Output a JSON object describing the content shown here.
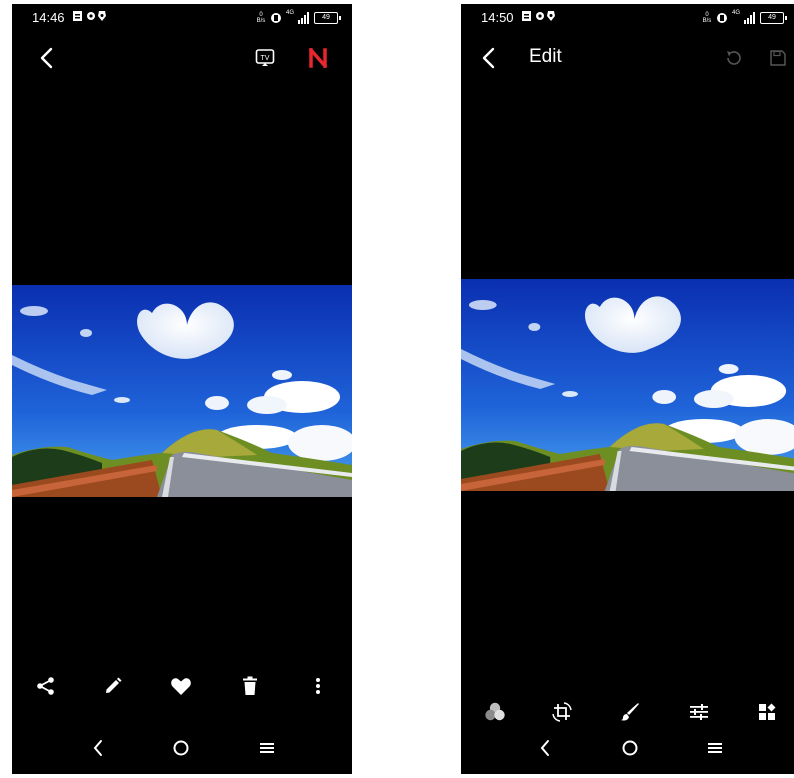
{
  "left_screen": {
    "status": {
      "time": "14:46",
      "netspeed_value": "0",
      "netspeed_unit": "B/s",
      "network": "4G",
      "battery": "49"
    },
    "toolbar_actions": [
      "share-icon",
      "edit-pencil-icon",
      "favorite-heart-icon",
      "delete-trash-icon",
      "more-vertical-icon"
    ],
    "top_actions": [
      "cast-tv-icon",
      "app-logo-icon"
    ],
    "accent": "#e8262e"
  },
  "right_screen": {
    "status": {
      "time": "14:50",
      "netspeed_value": "0",
      "netspeed_unit": "B/s",
      "network": "4G",
      "battery": "49"
    },
    "title": "Edit",
    "edit_tools": [
      "filters-icon",
      "crop-rotate-icon",
      "brush-icon",
      "adjust-sliders-icon",
      "more-tools-icon"
    ]
  },
  "navigation": [
    "back-icon",
    "home-icon",
    "recents-icon"
  ],
  "colors": {
    "background": "#000000",
    "foreground": "#ffffff",
    "disabled": "#555555"
  }
}
